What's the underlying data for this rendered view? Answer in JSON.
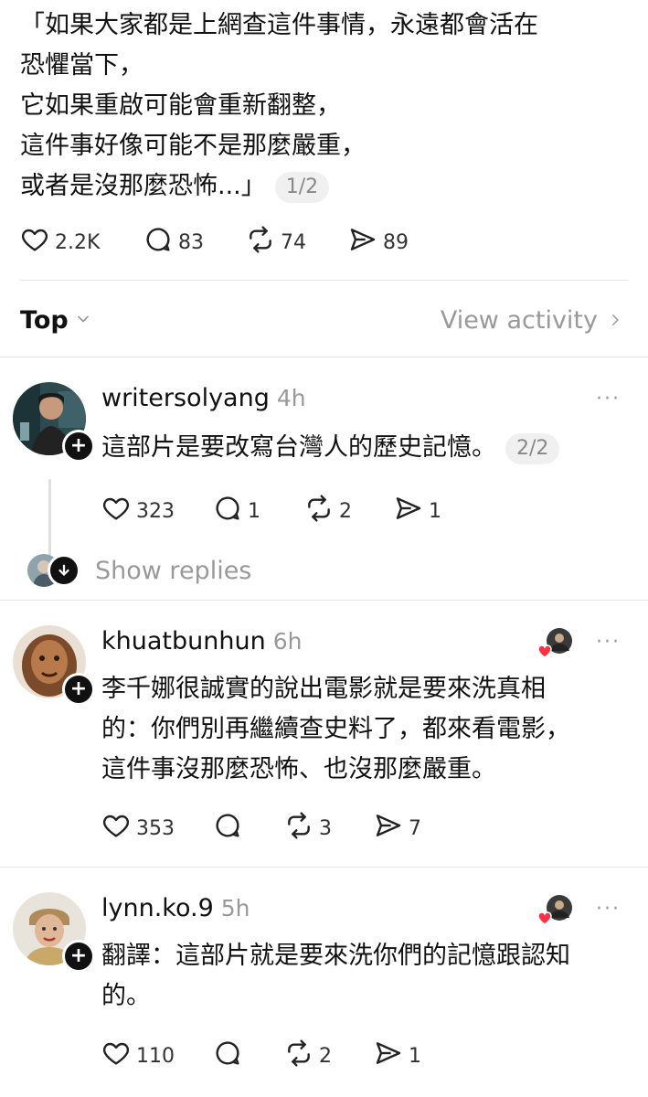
{
  "post": {
    "lines": [
      "「如果大家都是上網查這件事情，永遠都會活在",
      "恐懼當下，",
      "它如果重啟可能會重新翻整，",
      "這件事好像可能不是那麼嚴重，",
      "或者是沒那麼恐怖...」"
    ],
    "page_indicator": "1/2",
    "likes": "2.2K",
    "comments": "83",
    "reposts": "74",
    "shares": "89"
  },
  "sort": {
    "label": "Top",
    "view_activity": "View activity"
  },
  "replies": [
    {
      "username": "writersolyang",
      "time": "4h",
      "text_lines": [
        "這部片是要改寫台灣人的歷史記憶。"
      ],
      "page_indicator": "2/2",
      "likes": "323",
      "comments": "1",
      "reposts": "2",
      "shares": "1",
      "show_replies": "Show replies"
    },
    {
      "username": "khuatbunhun",
      "time": "6h",
      "text_lines": [
        "李千娜很誠實的說出電影就是要來洗真相",
        "的：你們別再繼續查史料了，都來看電影，",
        "這件事沒那麼恐怖、也沒那麼嚴重。"
      ],
      "likes": "353",
      "comments": "",
      "reposts": "3",
      "shares": "7"
    },
    {
      "username": "lynn.ko.9",
      "time": "5h",
      "text_lines": [
        "翻譯：這部片就是要來洗你們的記憶跟認知",
        "的。"
      ],
      "likes": "110",
      "comments": "",
      "reposts": "2",
      "shares": "1"
    }
  ],
  "icons": {
    "like": "heart-icon",
    "comment": "comment-bubble-icon",
    "repost": "repost-icon",
    "share": "send-icon",
    "follow": "plus-icon",
    "more": "more-dots-icon"
  },
  "colors": {
    "text": "#111111",
    "muted": "#999999",
    "liked_heart": "#ff3040"
  },
  "more_dots": "···",
  "plus": "+"
}
